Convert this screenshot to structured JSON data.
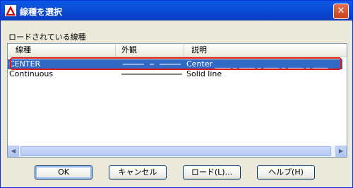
{
  "window": {
    "title": "線種を選択"
  },
  "group_label": "ロードされている線種",
  "table": {
    "columns": [
      "線種",
      "外観",
      "説明"
    ],
    "rows": [
      {
        "linetype": "CENTER",
        "description": "Center ____ _ ____ _ ____ _ ____ _ ____",
        "selected": true
      },
      {
        "linetype": "Continuous",
        "description": "Solid line",
        "selected": false
      }
    ]
  },
  "buttons": {
    "ok": "OK",
    "cancel": "キャンセル",
    "load": "ロード(L)...",
    "help": "ヘルプ(H)"
  },
  "colors": {
    "titlebar": "#0a58e3",
    "selection": "#316ac5",
    "highlight_outline": "#e01818"
  }
}
